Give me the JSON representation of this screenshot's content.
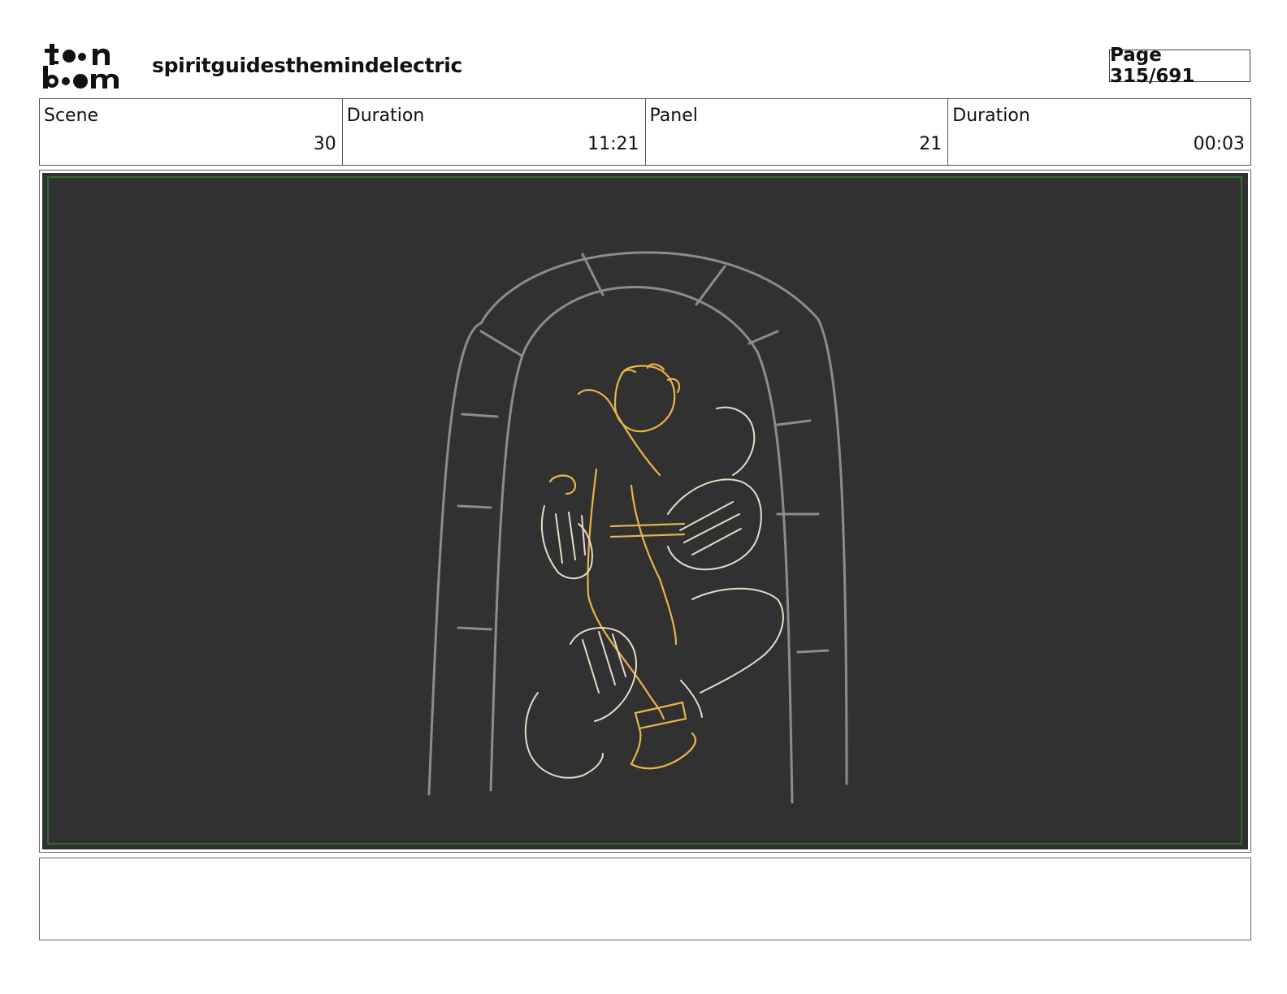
{
  "header": {
    "logo_alt": "toonboom",
    "project_title": "spiritguidesthemindelectric",
    "page_label": "Page 315/691"
  },
  "info": {
    "scene_label": "Scene",
    "scene_value": "30",
    "scene_duration_label": "Duration",
    "scene_duration_value": "11:21",
    "panel_label": "Panel",
    "panel_value": "21",
    "panel_duration_label": "Duration",
    "panel_duration_value": "00:03"
  },
  "colors": {
    "panel_background": "#313131",
    "safe_frame": "#2f6b2f",
    "arch_sketch": "#8c8c8c",
    "character_sketch": "#e8b44a",
    "hands_sketch": "#e6ddc8"
  },
  "notes": {
    "text": ""
  }
}
